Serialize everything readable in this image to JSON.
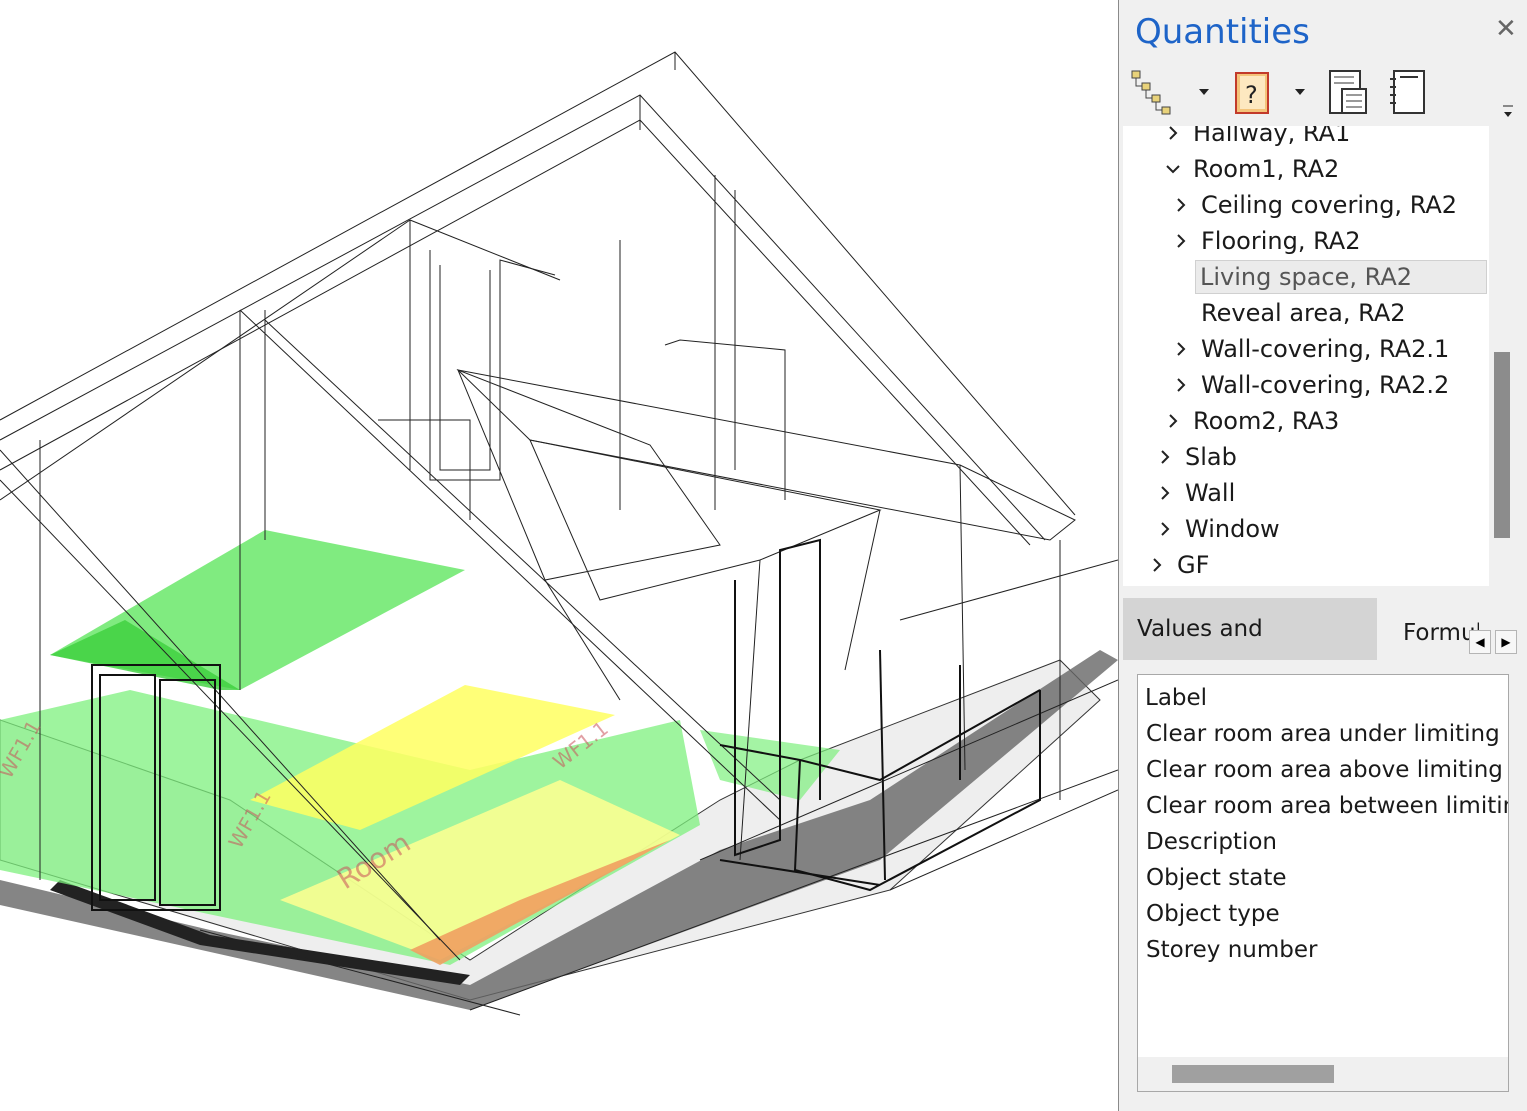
{
  "panel": {
    "title": "Quantities",
    "close_glyph": "✕"
  },
  "toolbar": {
    "buttons": [
      {
        "icon": "hierarchy-icon"
      },
      {
        "icon": "help-book-icon"
      },
      {
        "icon": "list-view-icon"
      },
      {
        "icon": "notebook-icon"
      }
    ],
    "dropdown_glyph": "▼"
  },
  "tree": {
    "items": [
      {
        "label": "Hallway, RA1",
        "expanded": false
      },
      {
        "label": "Room1, RA2",
        "expanded": true
      },
      {
        "label": "Ceiling covering, RA2",
        "expanded": false
      },
      {
        "label": "Flooring, RA2",
        "expanded": false
      },
      {
        "label": "Living space, RA2",
        "selected": true
      },
      {
        "label": "Reveal area, RA2"
      },
      {
        "label": "Wall-covering, RA2.1",
        "expanded": false
      },
      {
        "label": "Wall-covering, RA2.2",
        "expanded": false
      },
      {
        "label": "Room2, RA3",
        "expanded": false
      },
      {
        "label": "Slab",
        "expanded": false
      },
      {
        "label": "Wall",
        "expanded": false
      },
      {
        "label": "Window",
        "expanded": false
      },
      {
        "label": "GF",
        "expanded": false
      }
    ]
  },
  "tabs": {
    "active": "Values and attributes",
    "second": "Formulas",
    "left_arrow": "◀",
    "right_arrow": "▶"
  },
  "attributes": {
    "rows": [
      "Label",
      "Clear room area  under limiting roof",
      "Clear room area above limiting roof",
      "Clear room area between limiting roofs",
      "Description",
      "Object state",
      "Object type",
      "Storey number"
    ]
  },
  "colors": {
    "title_blue": "#1e64c8",
    "green_area": "#7df07d",
    "yellow_area": "#ffff80",
    "orange_area": "#f0a060"
  }
}
